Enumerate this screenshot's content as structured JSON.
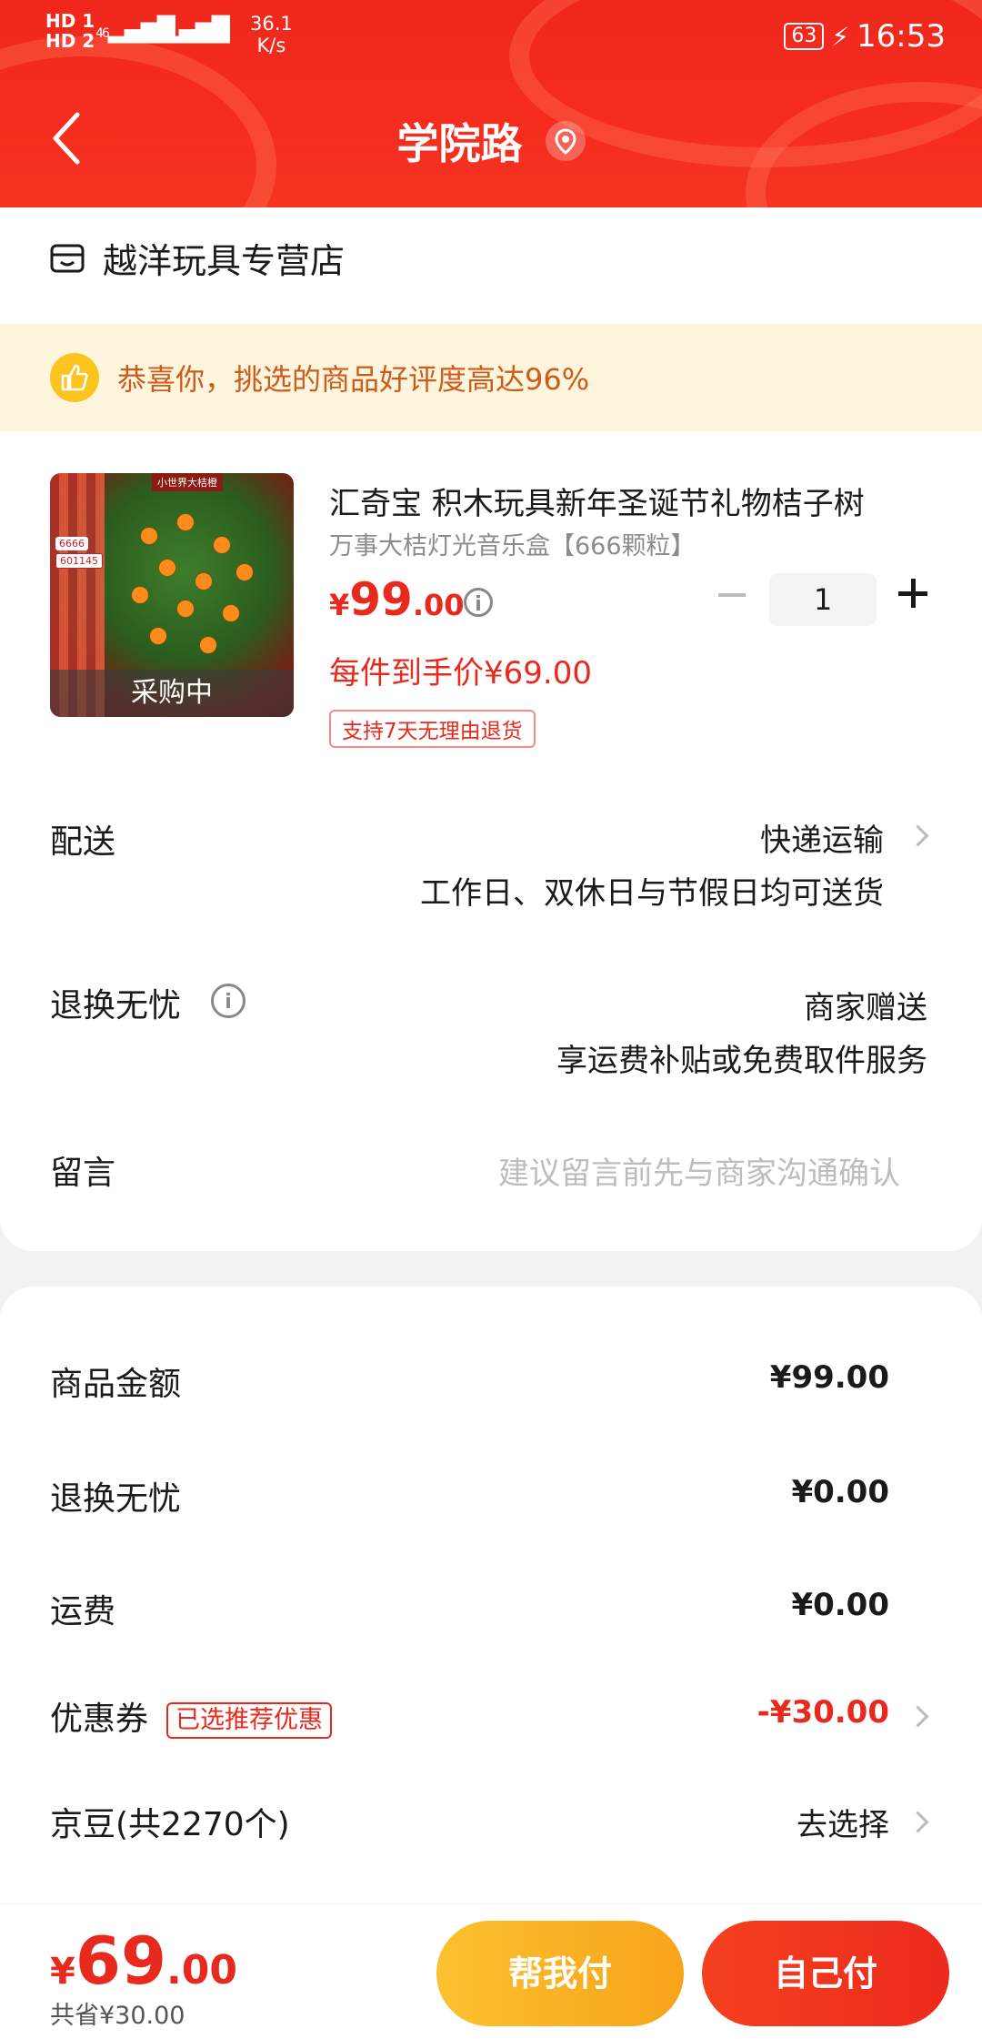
{
  "status_bar": {
    "hd1": "HD 1",
    "hd2": "HD 2",
    "sig1": "46",
    "sig2": "46",
    "speed": "36.1",
    "speed_unit": "K/s",
    "battery": "63",
    "time": "16:53"
  },
  "header": {
    "title": "学院路",
    "back_icon": "chevron-left-icon",
    "location_icon": "location-pin-icon"
  },
  "shop": {
    "name": "越洋玩具专营店",
    "icon": "store-icon"
  },
  "banner": {
    "text": "恭喜你，挑选的商品好评度高达96%",
    "icon": "thumbs-up-icon"
  },
  "product": {
    "title": "汇奇宝 积木玩具新年圣诞节礼物桔子树",
    "subtitle": "万事大桔灯光音乐盒【666颗粒】",
    "price_currency": "¥",
    "price_int": "99",
    "price_dec": ".00",
    "quantity": "1",
    "final_price": "每件到手价¥69.00",
    "return_tag": "支持7天无理由退货",
    "image_status": "采购中",
    "image_tag1": "6666",
    "image_tag2": "601145",
    "image_tag3": "小世界大桔橙"
  },
  "rows": {
    "delivery_label": "配送",
    "delivery_value": "快递运输",
    "delivery_note": "工作日、双休日与节假日均可送货",
    "returns_label": "退换无忧",
    "returns_value": "商家赠送",
    "returns_note": "享运费补贴或免费取件服务",
    "message_label": "留言",
    "message_placeholder": "建议留言前先与商家沟通确认"
  },
  "summary": {
    "goods_label": "商品金额",
    "goods_value": "¥99.00",
    "returns_label": "退换无忧",
    "returns_value": "¥0.00",
    "shipping_label": "运费",
    "shipping_value": "¥0.00",
    "coupon_label": "优惠券",
    "coupon_tag": "已选推荐优惠",
    "coupon_value": "-¥30.00",
    "beans_label": "京豆(共2270个)",
    "beans_value": "去选择"
  },
  "bottom": {
    "total_currency": "¥",
    "total_int": "69",
    "total_dec": ".00",
    "saved": "共省¥30.00",
    "help_pay": "帮我付",
    "self_pay": "自己付"
  },
  "colors": {
    "brand_red": "#f0281c",
    "price_red": "#e82a1e",
    "banner_bg": "#fdf6dd",
    "banner_text": "#cf5a1c",
    "help_button": "#fbc12e"
  }
}
